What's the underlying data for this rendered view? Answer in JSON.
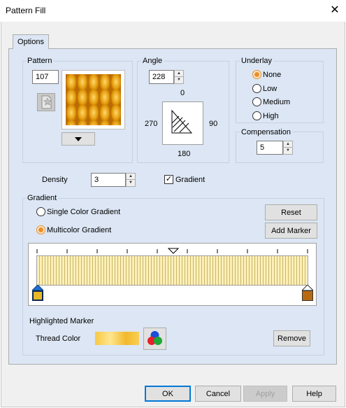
{
  "window": {
    "title": "Pattern Fill",
    "close_glyph": "✕"
  },
  "tabs": [
    {
      "label": "Options"
    }
  ],
  "pattern": {
    "label": "Pattern",
    "number": "107"
  },
  "angle": {
    "label": "Angle",
    "value": "228",
    "dial": {
      "top": "0",
      "left": "270",
      "right": "90",
      "bottom": "180"
    }
  },
  "underlay": {
    "label": "Underlay",
    "options": [
      "None",
      "Low",
      "Medium",
      "High"
    ],
    "selected": "None"
  },
  "compensation": {
    "label": "Compensation",
    "value": "5"
  },
  "density": {
    "label": "Density",
    "value": "3"
  },
  "gradient_check": {
    "label": "Gradient",
    "checked": true,
    "mark": "✓"
  },
  "gradient": {
    "label": "Gradient",
    "single_label": "Single Color Gradient",
    "multi_label": "Multicolor Gradient",
    "selected": "Multicolor Gradient",
    "reset_label": "Reset",
    "add_marker_label": "Add Marker",
    "markers": [
      {
        "color": "#e8b82a"
      },
      {
        "color": "#b86a10"
      }
    ]
  },
  "highlighted": {
    "label": "Highlighted Marker",
    "thread_label": "Thread Color",
    "remove_label": "Remove"
  },
  "footer": {
    "ok": "OK",
    "cancel": "Cancel",
    "apply": "Apply",
    "help": "Help"
  },
  "colors": {
    "accent": "#0078d7",
    "panel": "#dce6f4",
    "radio_selected": "#e8902c"
  }
}
